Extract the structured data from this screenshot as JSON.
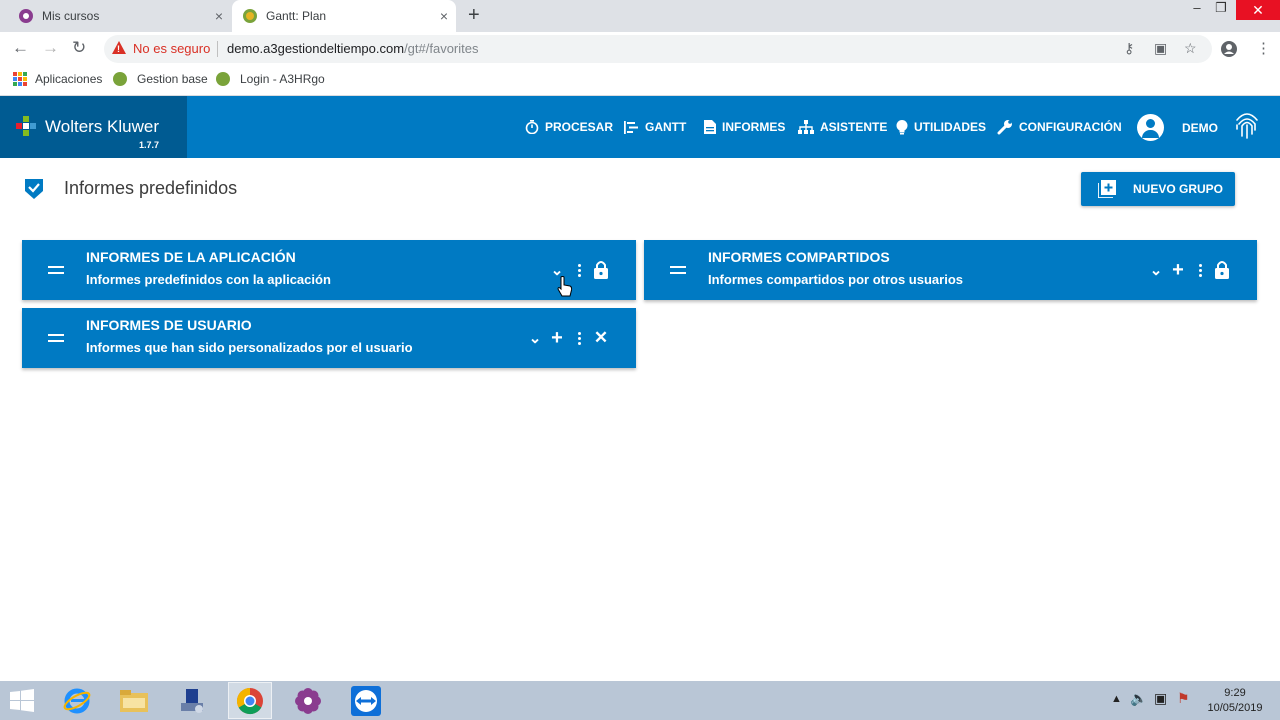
{
  "browser": {
    "tabs": [
      {
        "title": "Mis cursos",
        "active": false
      },
      {
        "title": "Gantt: Plan",
        "active": true
      }
    ],
    "new_tab_label": "+",
    "close_glyph": "×",
    "security_label": "No es seguro",
    "url_host": "demo.a3gestiondeltiempo.com",
    "url_path": "/gt#/favorites",
    "bookmarks": [
      {
        "label": "Aplicaciones",
        "icon": "apps-grid-icon"
      },
      {
        "label": "Gestion base",
        "icon": "globe-icon"
      },
      {
        "label": "Login - A3HRgo",
        "icon": "globe-icon"
      }
    ]
  },
  "app": {
    "brand_name": "Wolters Kluwer",
    "version": "1.7.7",
    "nav": [
      {
        "label": "PROCESAR",
        "icon": "stopwatch-icon"
      },
      {
        "label": "GANTT",
        "icon": "gantt-icon"
      },
      {
        "label": "INFORMES",
        "icon": "document-icon"
      },
      {
        "label": "ASISTENTE",
        "icon": "hierarchy-icon"
      },
      {
        "label": "UTILIDADES",
        "icon": "lightbulb-icon"
      },
      {
        "label": "CONFIGURACIÓN",
        "icon": "wrench-icon"
      }
    ],
    "user": "DEMO",
    "colors": {
      "primary": "#007ac3",
      "brand_dark": "#005b92"
    }
  },
  "page": {
    "title": "Informes predefinidos",
    "new_group_label": "NUEVO GRUPO",
    "groups": [
      {
        "title": "INFORMES DE LA APLICACIÓN",
        "subtitle": "Informes predefinidos con la aplicación",
        "actions": [
          "expand",
          "more",
          "lock"
        ]
      },
      {
        "title": "INFORMES COMPARTIDOS",
        "subtitle": "Informes compartidos por otros usuarios",
        "actions": [
          "expand",
          "add",
          "more",
          "lock"
        ]
      },
      {
        "title": "INFORMES DE USUARIO",
        "subtitle": "Informes que han sido personalizados por el usuario",
        "actions": [
          "expand",
          "add",
          "more",
          "delete"
        ]
      }
    ]
  },
  "taskbar": {
    "time": "9:29",
    "date": "10/05/2019"
  }
}
